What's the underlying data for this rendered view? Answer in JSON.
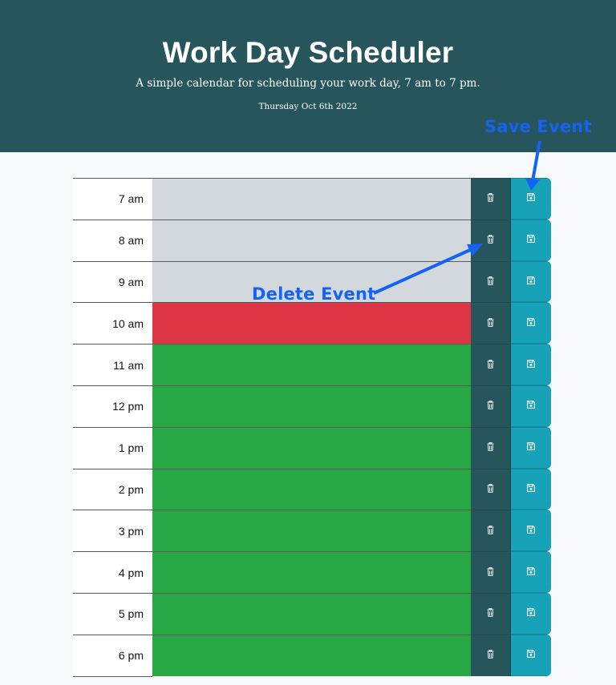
{
  "header": {
    "title": "Work Day Scheduler",
    "lead": "A simple calendar for scheduling your work day, 7 am to 7 pm.",
    "current_day": "Thursday Oct 6th 2022"
  },
  "rows": [
    {
      "hour": "7 am",
      "status": "past",
      "text": ""
    },
    {
      "hour": "8 am",
      "status": "past",
      "text": ""
    },
    {
      "hour": "9 am",
      "status": "past",
      "text": ""
    },
    {
      "hour": "10 am",
      "status": "present",
      "text": ""
    },
    {
      "hour": "11 am",
      "status": "future",
      "text": ""
    },
    {
      "hour": "12 pm",
      "status": "future",
      "text": ""
    },
    {
      "hour": "1 pm",
      "status": "future",
      "text": ""
    },
    {
      "hour": "2 pm",
      "status": "future",
      "text": ""
    },
    {
      "hour": "3 pm",
      "status": "future",
      "text": ""
    },
    {
      "hour": "4 pm",
      "status": "future",
      "text": ""
    },
    {
      "hour": "5 pm",
      "status": "future",
      "text": ""
    },
    {
      "hour": "6 pm",
      "status": "future",
      "text": ""
    }
  ],
  "icons": {
    "delete": "trash-icon",
    "save": "floppy-disk-icon"
  },
  "annotations": {
    "save_label": "Save Event",
    "delete_label": "Delete Event"
  },
  "colors": {
    "header_bg": "#26555c",
    "past": "#d3d8dc",
    "present": "#dc3545",
    "future": "#28a745",
    "delete_btn": "#26555c",
    "save_btn": "#17a2b8",
    "annotation": "#1463f3"
  }
}
